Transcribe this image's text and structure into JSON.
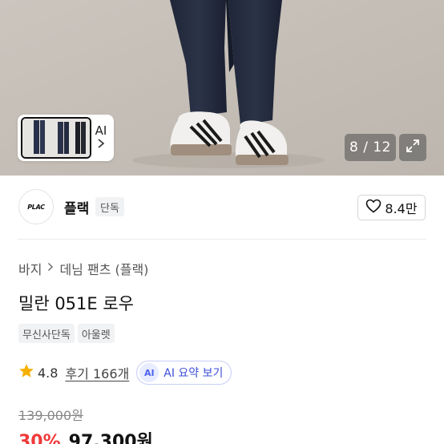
{
  "gallery": {
    "thumb_ai_label": "AI",
    "counter": "8 / 12",
    "icons": {
      "chevron": "chevron-right-icon",
      "expand": "expand-arrows-icon"
    }
  },
  "brand": {
    "logo_text": "PLAC",
    "name": "플랙",
    "badge": "단독",
    "like_count": "8.4만",
    "like_icon": "heart-outline-icon"
  },
  "breadcrumb": {
    "category": "바지",
    "subcategory": "데님 팬츠 (플랙)"
  },
  "product": {
    "title": "밀란 051E 로우",
    "tags": [
      "무신사단독",
      "아울렛"
    ]
  },
  "rating": {
    "score": "4.8",
    "reviews_label": "후기 166개",
    "ai_badge": "AI",
    "ai_summary_label": "AI 요약 보기",
    "star_color": "#f5b000"
  },
  "price": {
    "original": "139,000원",
    "discount": "30%",
    "sale": "97,300원",
    "discount_color": "#f03a3a"
  }
}
